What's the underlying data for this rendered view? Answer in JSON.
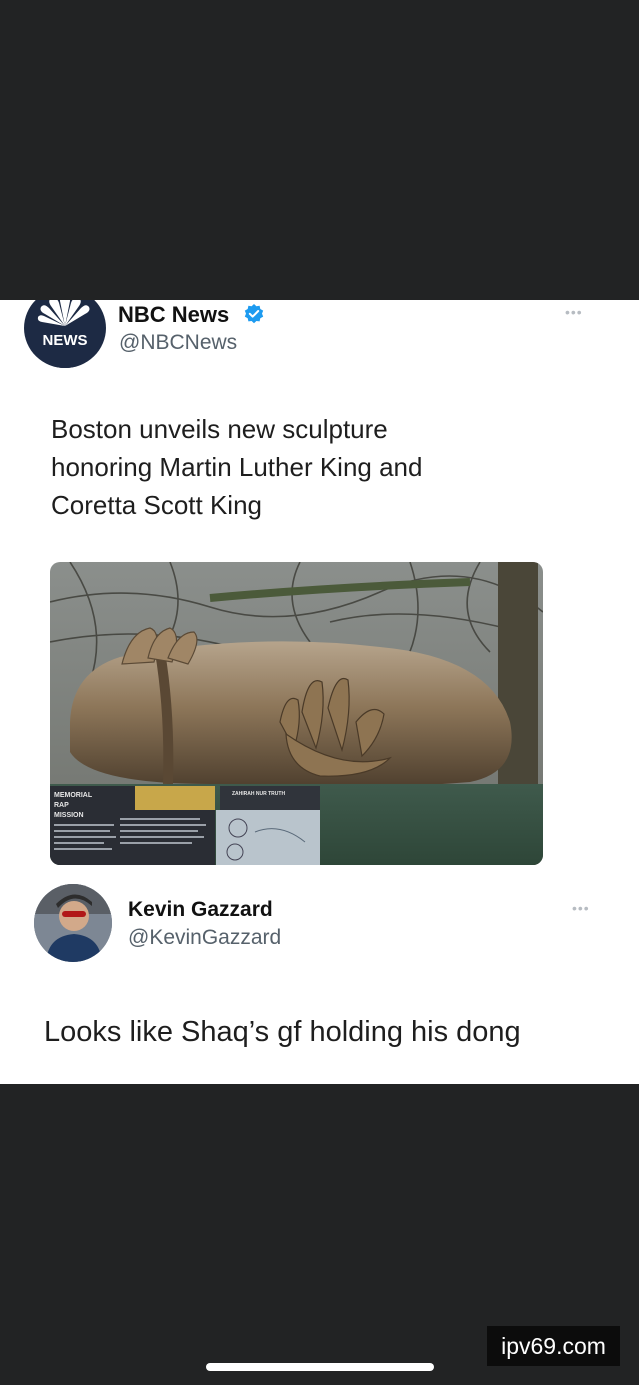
{
  "tweet": {
    "author_name": "NBC News",
    "author_handle": "@NBCNews",
    "avatar_text": "NEWS",
    "text_lines": [
      "Boston unveils new sculpture",
      "honoring Martin Luther King and",
      "Coretta Scott King"
    ],
    "more": "•••"
  },
  "photo": {
    "sign_left_lines": [
      "MEMORIAL",
      "RAP",
      "MISSION"
    ],
    "sign_right": "ZAHIRAH NUR TRUTH"
  },
  "reply": {
    "author_name": "Kevin Gazzard",
    "author_handle": "@KevinGazzard",
    "text": "Looks like Shaq’s gf holding his dong",
    "more": "•••"
  },
  "watermark": "ipv69.com",
  "colors": {
    "background_dark": "#222324",
    "card": "#ffffff",
    "verified_blue": "#1d9bf0",
    "nbc_avatar": "#1d2a44"
  }
}
